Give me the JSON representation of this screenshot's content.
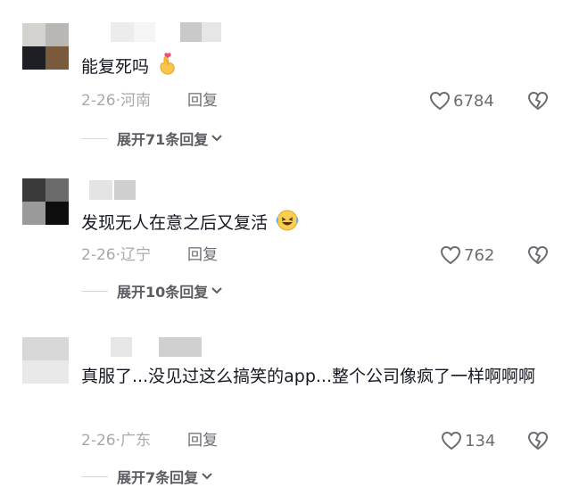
{
  "comments": [
    {
      "text": "能复死吗",
      "emoji": "finger-heart-emoji",
      "date": "2-26",
      "location": "河南",
      "reply_label": "回复",
      "likes": "6784",
      "expand_label": "展开71条回复"
    },
    {
      "text": "发现无人在意之后又复活",
      "emoji": "laughing-crying-emoji",
      "date": "2-26",
      "location": "辽宁",
      "reply_label": "回复",
      "likes": "762",
      "expand_label": "展开10条回复"
    },
    {
      "text": "真服了...没见过这么搞笑的app...整个公司像疯了一样啊啊啊",
      "emoji": "",
      "date": "2-26",
      "location": "广东",
      "reply_label": "回复",
      "likes": "134",
      "expand_label": "展开7条回复"
    }
  ],
  "date_location_separator": "·",
  "colors": {
    "text_primary": "#161823",
    "text_meta": "#a8a9ad",
    "text_secondary": "#6c6d72",
    "background": "#ffffff"
  }
}
